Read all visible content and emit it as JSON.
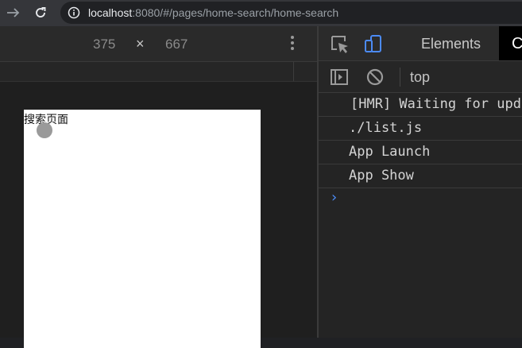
{
  "browser": {
    "url_host": "localhost",
    "url_rest": ":8080/#/pages/home-search/home-search",
    "icons": [
      "forward-arrow-icon",
      "reload-icon",
      "info-icon"
    ]
  },
  "device_toolbar": {
    "width": "375",
    "separator": "×",
    "height": "667"
  },
  "page": {
    "title": "搜索页面"
  },
  "devtools": {
    "tabs": {
      "elements": "Elements",
      "console": "C"
    },
    "context": "top",
    "console_lines": [
      "[HMR] Waiting for upd",
      "./list.js",
      "App Launch",
      "App Show"
    ],
    "prompt": "›"
  },
  "colors": {
    "accent_blue": "#4c8bf5",
    "panel_bg": "#242424",
    "page_bg": "#ffffff"
  }
}
